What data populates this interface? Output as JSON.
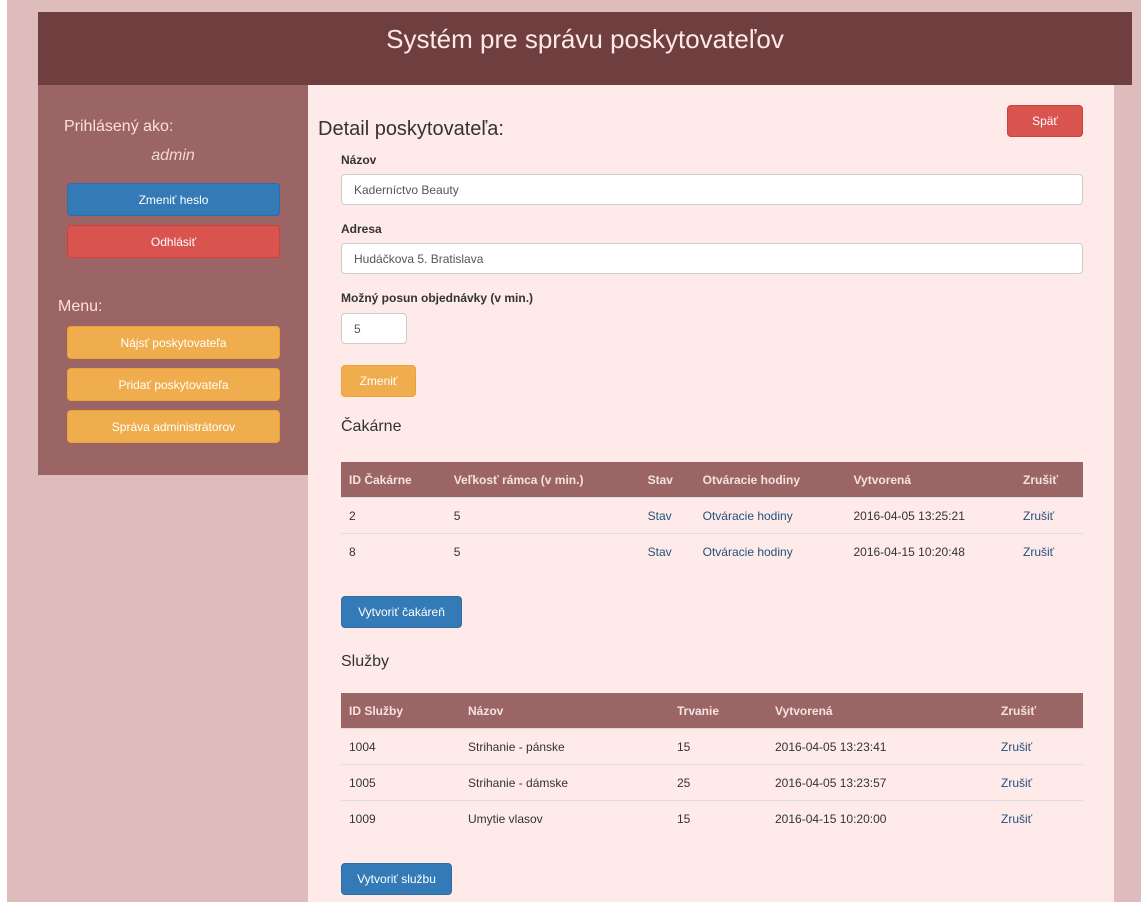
{
  "app": {
    "title": "Systém pre správu poskytovateľov"
  },
  "sidebar": {
    "logged_in_label": "Prihlásený ako:",
    "username": "admin",
    "change_password": "Zmeniť heslo",
    "logout": "Odhlásiť",
    "menu_label": "Menu:",
    "menu_items": [
      {
        "label": "Nájsť poskytovateľa"
      },
      {
        "label": "Pridať poskytovateľa"
      },
      {
        "label": "Správa administrátorov"
      }
    ]
  },
  "main": {
    "heading": "Detail poskytovateľa:",
    "back_button": "Späť",
    "form": {
      "name_label": "Názov",
      "name_value": "Kaderníctvo Beauty",
      "address_label": "Adresa",
      "address_value": "Hudáčkova 5. Bratislava",
      "shift_label": "Možný posun objednávky (v min.)",
      "shift_value": "5",
      "submit": "Zmeniť"
    },
    "waiting_rooms": {
      "heading": "Čakárne",
      "columns": [
        "ID Čakárne",
        "Veľkosť rámca (v min.)",
        "Stav",
        "Otváracie hodiny",
        "Vytvorená",
        "Zrušiť"
      ],
      "rows": [
        {
          "id": "2",
          "frame": "5",
          "status": "Stav",
          "hours": "Otváracie hodiny",
          "created": "2016-04-05 13:25:21",
          "cancel": "Zrušiť"
        },
        {
          "id": "8",
          "frame": "5",
          "status": "Stav",
          "hours": "Otváracie hodiny",
          "created": "2016-04-15 10:20:48",
          "cancel": "Zrušiť"
        }
      ],
      "create_button": "Vytvoriť čakáreň"
    },
    "services": {
      "heading": "Služby",
      "columns": [
        "ID Služby",
        "Názov",
        "Trvanie",
        "Vytvorená",
        "Zrušiť"
      ],
      "rows": [
        {
          "id": "1004",
          "name": "Strihanie - pánske",
          "duration": "15",
          "created": "2016-04-05 13:23:41",
          "cancel": "Zrušiť"
        },
        {
          "id": "1005",
          "name": "Strihanie - dámske",
          "duration": "25",
          "created": "2016-04-05 13:23:57",
          "cancel": "Zrušiť"
        },
        {
          "id": "1009",
          "name": "Umytie vlasov",
          "duration": "15",
          "created": "2016-04-15 10:20:00",
          "cancel": "Zrušiť"
        }
      ],
      "create_button": "Vytvoriť službu"
    }
  }
}
